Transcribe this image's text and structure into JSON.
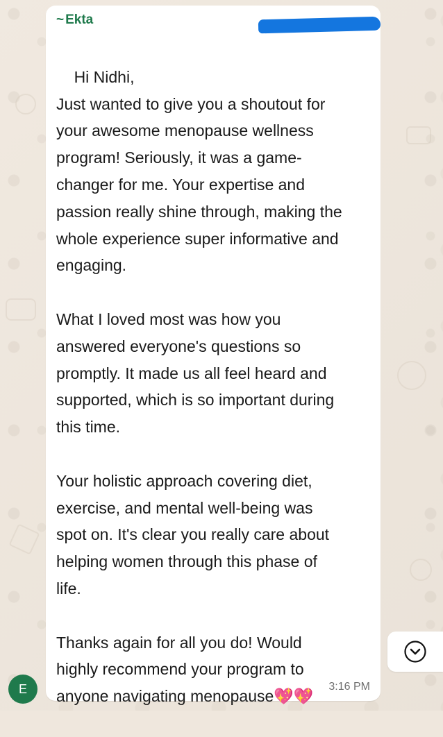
{
  "chat": {
    "sender_name": "Ekta",
    "message_lines": [
      "Hi Nidhi,",
      "Just wanted to give you a shoutout for",
      "your awesome menopause wellness",
      "program! Seriously, it was a game-",
      "changer for me. Your expertise and",
      "passion really shine through, making the",
      "whole experience super informative and",
      "engaging.",
      "",
      "What I loved most was how you",
      "answered everyone's questions so",
      "promptly. It made us all feel heard and",
      "supported, which is so important during",
      "this time.",
      "",
      "Your holistic approach covering diet,",
      "exercise, and mental well-being was",
      "spot on. It's clear you really care about",
      "helping women through this phase of",
      "life.",
      "",
      "Thanks again for all you do! Would",
      "highly recommend your program to",
      "anyone navigating menopause💖💖"
    ],
    "time": "3:16 PM",
    "avatar_initial": "E"
  },
  "colors": {
    "background": "#efe7dd",
    "bubble": "#ffffff",
    "sender": "#1f7a4c",
    "timestamp": "#6f6f6f",
    "redaction": "#1476df"
  },
  "icons": {
    "scroll_down": "chevron-down-circle-icon"
  }
}
